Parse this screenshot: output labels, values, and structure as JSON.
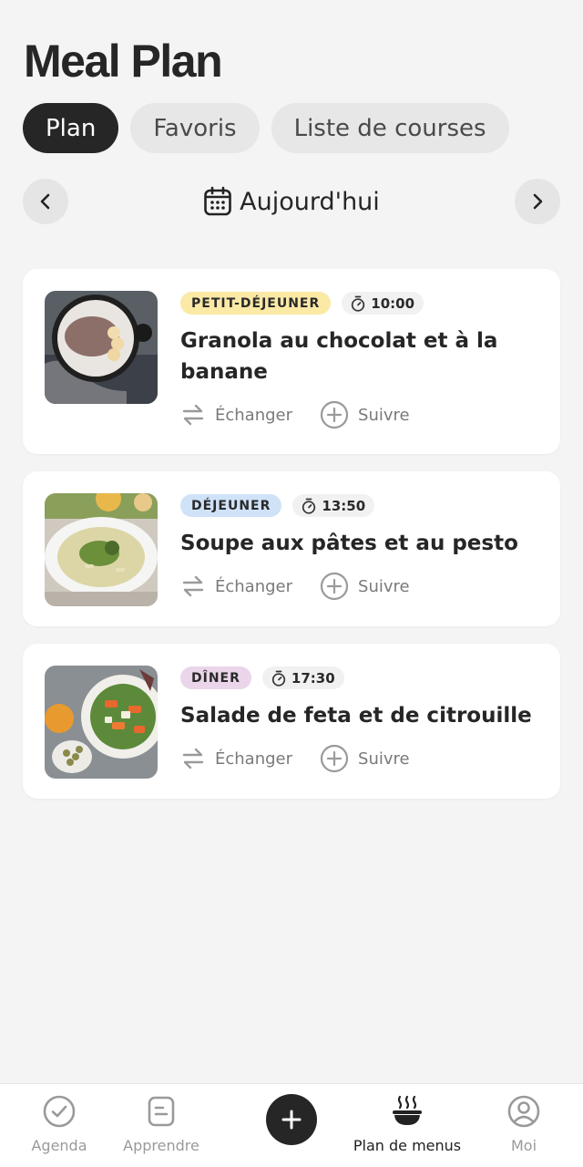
{
  "page": {
    "title": "Meal Plan"
  },
  "tabs": [
    {
      "label": "Plan"
    },
    {
      "label": "Favoris"
    },
    {
      "label": "Liste de courses"
    }
  ],
  "date_nav": {
    "label": "Aujourd'hui"
  },
  "actions": {
    "swap": "Échanger",
    "track": "Suivre"
  },
  "meals": [
    {
      "tag": "PETIT-DÉJEUNER",
      "tag_color": "#fbe9a6",
      "time": "10:00",
      "name": "Granola au chocolat et à la banane"
    },
    {
      "tag": "DÉJEUNER",
      "tag_color": "#cfe2f8",
      "time": "13:50",
      "name": "Soupe aux pâtes et au pesto"
    },
    {
      "tag": "DÎNER",
      "tag_color": "#ead5ea",
      "time": "17:30",
      "name": "Salade de feta et de citrouille"
    }
  ],
  "bottom_nav": [
    {
      "label": "Agenda",
      "icon": "check-circle-icon"
    },
    {
      "label": "Apprendre",
      "icon": "document-icon"
    },
    {
      "label": "Plan de menus",
      "icon": "bowl-icon",
      "active": true
    },
    {
      "label": "Moi",
      "icon": "user-icon"
    }
  ]
}
